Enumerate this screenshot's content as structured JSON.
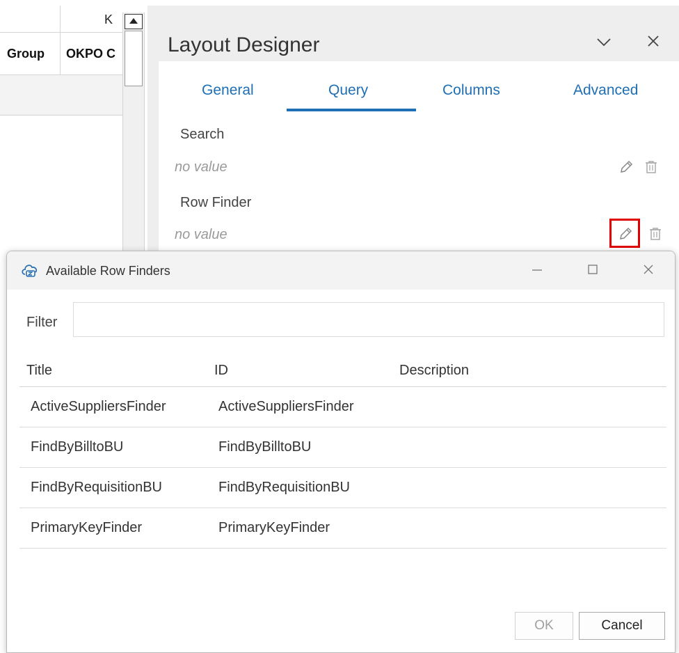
{
  "spreadsheet": {
    "column_letter": "K",
    "headers": [
      "Group",
      "OKPO C"
    ]
  },
  "designer": {
    "title": "Layout Designer",
    "collapse_icon": "chevron-down-icon",
    "close_icon": "close-icon",
    "tabs": [
      {
        "label": "General"
      },
      {
        "label": "Query"
      },
      {
        "label": "Columns"
      },
      {
        "label": "Advanced"
      }
    ],
    "active_tab": "Query",
    "fields": {
      "search": {
        "label": "Search",
        "value": "no value"
      },
      "row_finder": {
        "label": "Row Finder",
        "value": "no value"
      }
    }
  },
  "dialog": {
    "title": "Available Row Finders",
    "logo_icon": "cloud-logo-icon",
    "filter": {
      "label": "Filter",
      "value": "",
      "placeholder": ""
    },
    "columns": [
      "Title",
      "ID",
      "Description"
    ],
    "rows": [
      {
        "title": "ActiveSuppliersFinder",
        "id": "ActiveSuppliersFinder",
        "description": ""
      },
      {
        "title": "FindByBilltoBU",
        "id": "FindByBilltoBU",
        "description": ""
      },
      {
        "title": "FindByRequisitionBU",
        "id": "FindByRequisitionBU",
        "description": ""
      },
      {
        "title": "PrimaryKeyFinder",
        "id": "PrimaryKeyFinder",
        "description": ""
      }
    ],
    "ok_label": "OK",
    "cancel_label": "Cancel"
  },
  "colors": {
    "accent": "#1e6fb5",
    "highlight": "#e00000"
  }
}
